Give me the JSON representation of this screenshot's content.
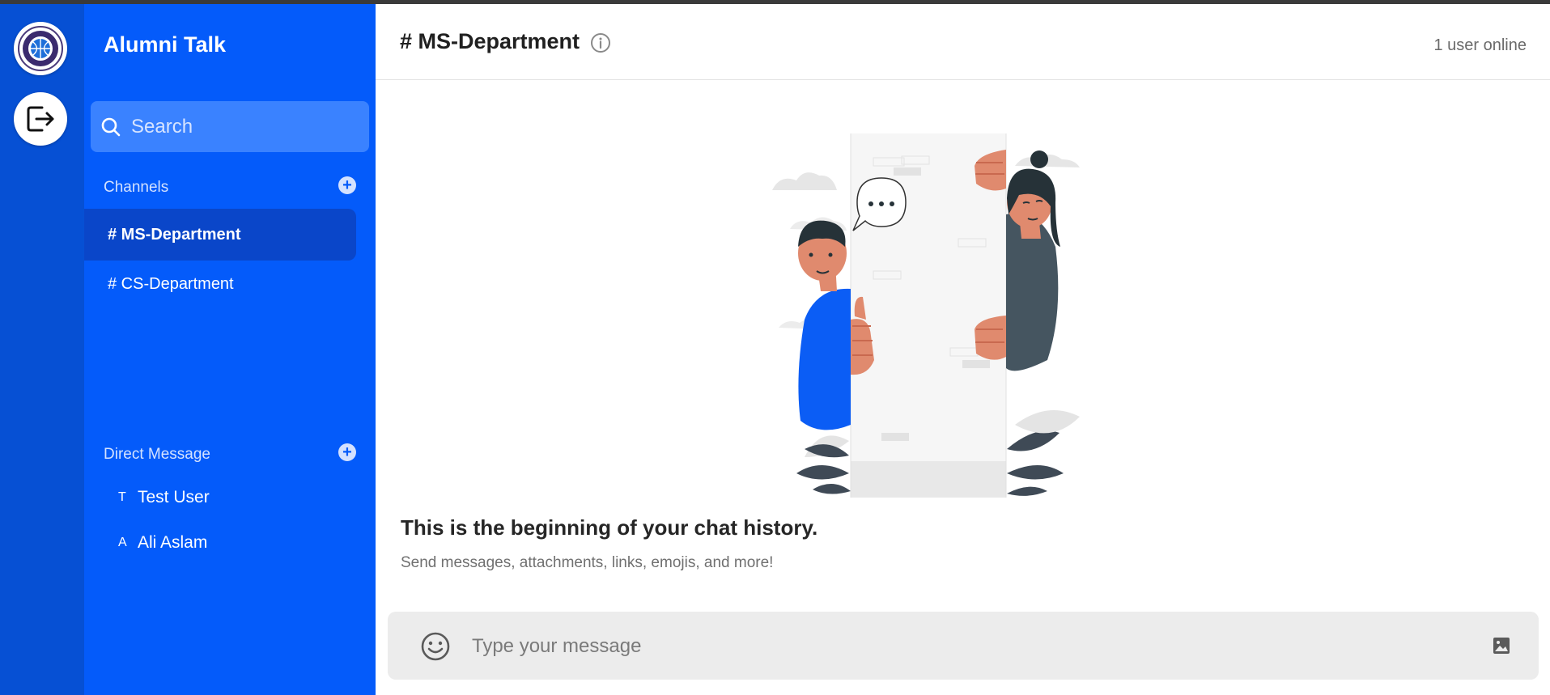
{
  "rail": {
    "logo_icon": "university-seal-icon",
    "exit_icon": "logout-icon"
  },
  "sidebar": {
    "app_title": "Alumni Talk",
    "search": {
      "placeholder": "Search"
    },
    "channels_label": "Channels",
    "channels": [
      {
        "label": "# MS-Department",
        "active": true
      },
      {
        "label": "# CS-Department",
        "active": false
      }
    ],
    "dm_label": "Direct Message",
    "direct_messages": [
      {
        "initial": "T",
        "name": "Test User"
      },
      {
        "initial": "A",
        "name": "Ali Aslam"
      }
    ]
  },
  "header": {
    "channel_title": "# MS-Department",
    "online_status": "1 user online"
  },
  "main": {
    "history_title": "This is the beginning of your chat history.",
    "history_subtitle": "Send messages, attachments, links, emojis, and more!"
  },
  "composer": {
    "placeholder": "Type your message"
  },
  "colors": {
    "rail_bg": "#0650d4",
    "sidebar_bg": "#045bfa",
    "active_channel_bg": "#0a46c9",
    "search_bg": "#3a82ff",
    "composer_bg": "#ececec"
  }
}
